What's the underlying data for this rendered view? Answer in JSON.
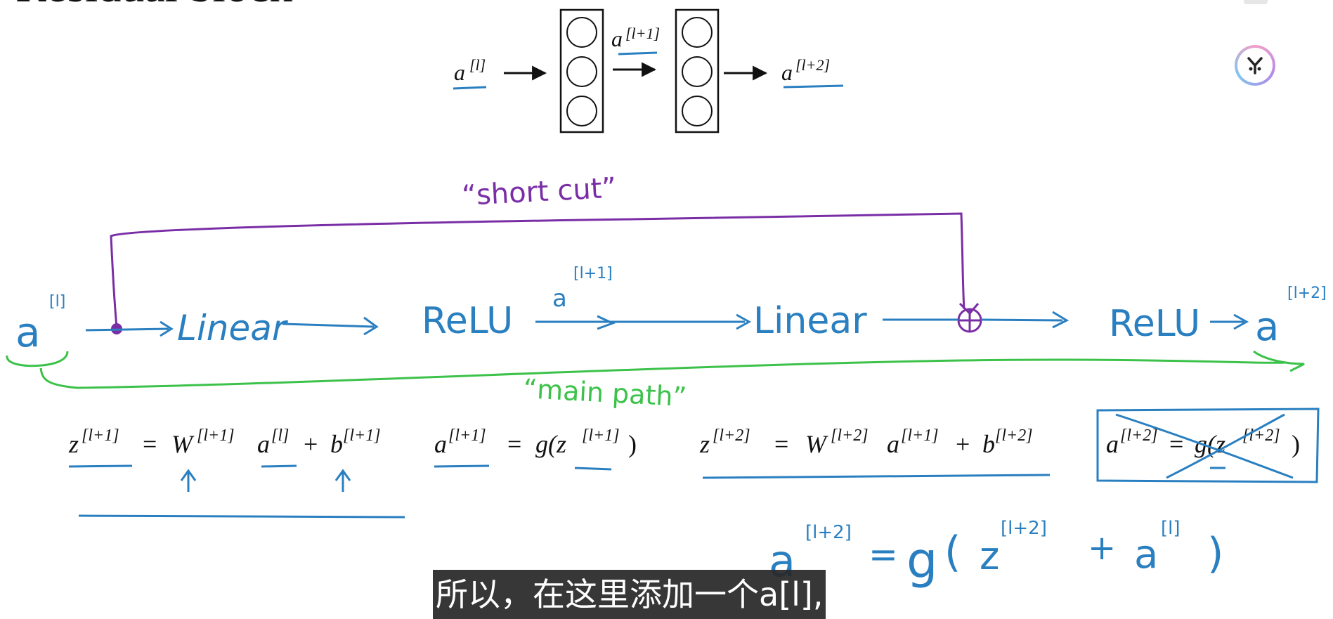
{
  "slide": {
    "title": "Residual block"
  },
  "network": {
    "input_base": "a",
    "input_sup": "[l]",
    "mid_base": "a",
    "mid_sup": "[l+1]",
    "output_base": "a",
    "output_sup": "[l+2]"
  },
  "handwriting": {
    "shortcut_label": "“short cut”",
    "main_path_label": "“main path”",
    "input_a": "a",
    "input_sup": "[l]",
    "linear_1": "Linear",
    "relu_1": "ReLU",
    "mid_a": "a",
    "mid_sup": "[l+1]",
    "linear_2": "Linear",
    "relu_2": "ReLU",
    "output_a": "a",
    "output_sup": "[l+2]"
  },
  "equations": {
    "eq1": {
      "z_sup": "[l+1]",
      "w_sup": "[l+1]",
      "a_sup": "[l]",
      "b_sup": "[l+1]"
    },
    "eq2": {
      "a_sup": "[l+1]",
      "z_sup": "[l+1]"
    },
    "eq3": {
      "z_sup": "[l+2]",
      "w_sup": "[l+2]",
      "a_sup": "[l+1]",
      "b_sup": "[l+2]"
    },
    "eq4": {
      "a_sup": "[l+2]",
      "z_sup": "[l+2]"
    },
    "new_eq": {
      "a": "a",
      "a_sup": "[l+2]",
      "g": "g",
      "z": "z",
      "z_sup": "[l+2]",
      "a2": "a",
      "a2_sup": "[l]"
    }
  },
  "subtitle": {
    "text": "所以，在这里添加一个a[l],"
  },
  "colors": {
    "ink_black": "#111111",
    "ink_blue": "#2a7fc0",
    "ink_purple": "#7a2ea6",
    "ink_green": "#3cc24a",
    "subtitle_bg": "#282828",
    "subtitle_text": "#ffffff"
  },
  "icons": {
    "logo": "deeplearning-ai-logo-icon",
    "arrow": "arrow-right-icon",
    "neuron": "neuron-circle-icon",
    "plus_node": "circled-plus-icon"
  }
}
